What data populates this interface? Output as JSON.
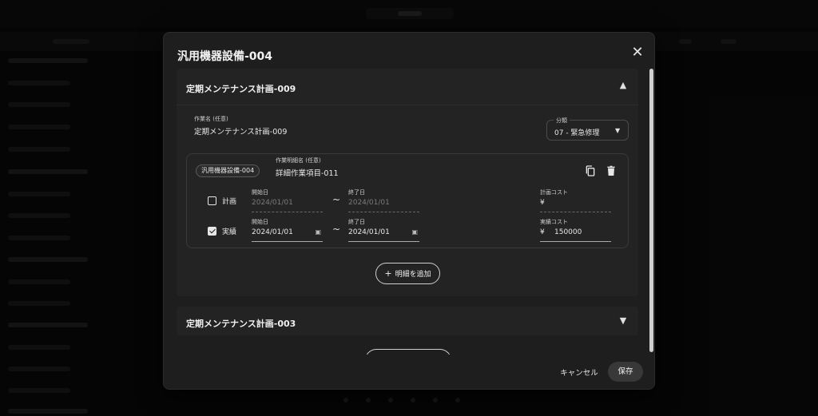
{
  "dialog": {
    "title": "汎用機器設備-004",
    "cancel_label": "キャンセル",
    "save_label": "保存"
  },
  "sections": [
    {
      "title": "定期メンテナンス計画-009",
      "expanded": true,
      "work_name_label": "作業名 (任意)",
      "work_name_value": "定期メンテナンス計画-009",
      "category_label": "分類",
      "category_value": "07 - 緊急修理",
      "detail": {
        "equipment_chip": "汎用機器設備-004",
        "detail_name_label": "作業明細名 (任意)",
        "detail_name_value": "詳細作業項目-011",
        "plan": {
          "checkbox_label": "計画",
          "checked": false,
          "start_label": "開始日",
          "start_value": "2024/01/01",
          "end_label": "終了日",
          "end_value": "2024/01/01",
          "cost_label": "計画コスト",
          "cost_currency": "¥",
          "cost_value": ""
        },
        "actual": {
          "checkbox_label": "実績",
          "checked": true,
          "start_label": "開始日",
          "start_value": "2024/01/01",
          "end_label": "終了日",
          "end_value": "2024/01/01",
          "cost_label": "実績コスト",
          "cost_currency": "¥",
          "cost_value": "150000"
        },
        "range_separator": "~"
      },
      "add_detail_label": "明細を追加"
    },
    {
      "title": "定期メンテナンス計画-003",
      "expanded": false
    }
  ],
  "icons": {
    "close": "close-icon",
    "expand_less": "chevron-up-icon",
    "expand_more": "chevron-down-icon",
    "copy": "copy-icon",
    "delete": "trash-icon",
    "calendar": "calendar-icon",
    "add": "plus-icon",
    "dropdown": "caret-down-icon"
  }
}
